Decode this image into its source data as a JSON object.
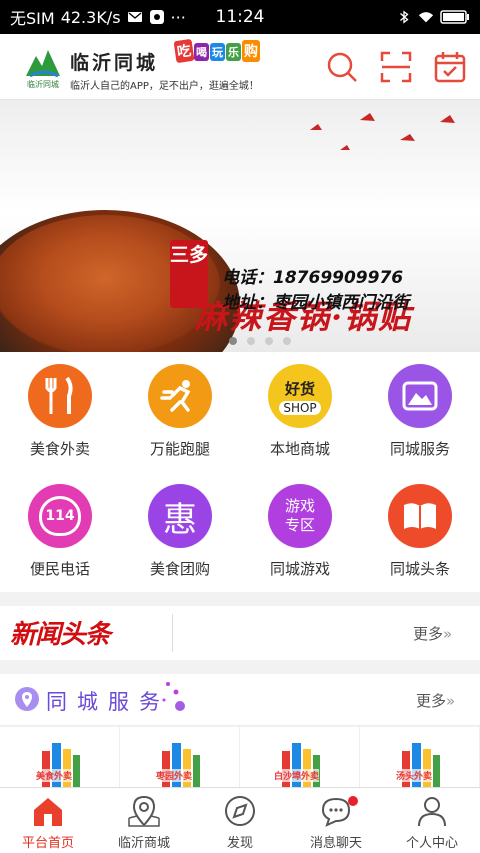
{
  "status_bar": {
    "carrier": "无SIM",
    "speed": "42.3K/s",
    "time": "11:24"
  },
  "header": {
    "logo_text": "临沂同城",
    "brand": "临沂同城",
    "slogan": "临沂人自己的APP，足不出户，逛遍全城！",
    "badge": [
      "吃",
      "喝",
      "玩",
      "乐",
      "购"
    ],
    "icons": [
      "search-icon",
      "scan-icon",
      "calendar-icon"
    ]
  },
  "banner": {
    "tag": "三多",
    "title": "麻辣香锅·锅贴",
    "phone": "电话：18769909976",
    "address": "地址：枣园小镇西门沿街",
    "dots": 4,
    "active_dot": 1
  },
  "grid": [
    {
      "label": "美食外卖",
      "icon": "fork-knife-icon",
      "color": "#f06a1e"
    },
    {
      "label": "万能跑腿",
      "icon": "runner-icon",
      "color": "#f39a14"
    },
    {
      "label": "本地商城",
      "icon": "goods-shop-icon",
      "color": "#f4c51c",
      "badge_top": "好货",
      "badge_bottom": "SHOP"
    },
    {
      "label": "同城服务",
      "icon": "mountain-icon",
      "color": "#9b55e6"
    },
    {
      "label": "便民电话",
      "icon": "phone-114-icon",
      "color": "#e33bb4",
      "badge_top": "114"
    },
    {
      "label": "美食团购",
      "icon": "hui-icon",
      "color": "#9b44e6",
      "badge_top": "惠"
    },
    {
      "label": "同城游戏",
      "icon": "game-icon",
      "color": "#b13fe0",
      "badge_top": "游戏",
      "badge_bottom": "专区"
    },
    {
      "label": "同城头条",
      "icon": "book-icon",
      "color": "#ee4b2b"
    }
  ],
  "news": {
    "logo": "新闻头条",
    "more": "更多"
  },
  "service": {
    "title": "同城服务",
    "more": "更多",
    "items": [
      {
        "caption": "美食外卖"
      },
      {
        "caption": "枣园外卖"
      },
      {
        "caption": "白沙埠外卖"
      },
      {
        "caption": "汤头外卖"
      }
    ]
  },
  "tabbar": [
    {
      "label": "平台首页",
      "icon": "home-icon",
      "active": true
    },
    {
      "label": "临沂商城",
      "icon": "map-pin-icon",
      "active": false
    },
    {
      "label": "发现",
      "icon": "compass-icon",
      "active": false
    },
    {
      "label": "消息聊天",
      "icon": "chat-icon",
      "active": false,
      "dot": true
    },
    {
      "label": "个人中心",
      "icon": "user-icon",
      "active": false
    }
  ]
}
